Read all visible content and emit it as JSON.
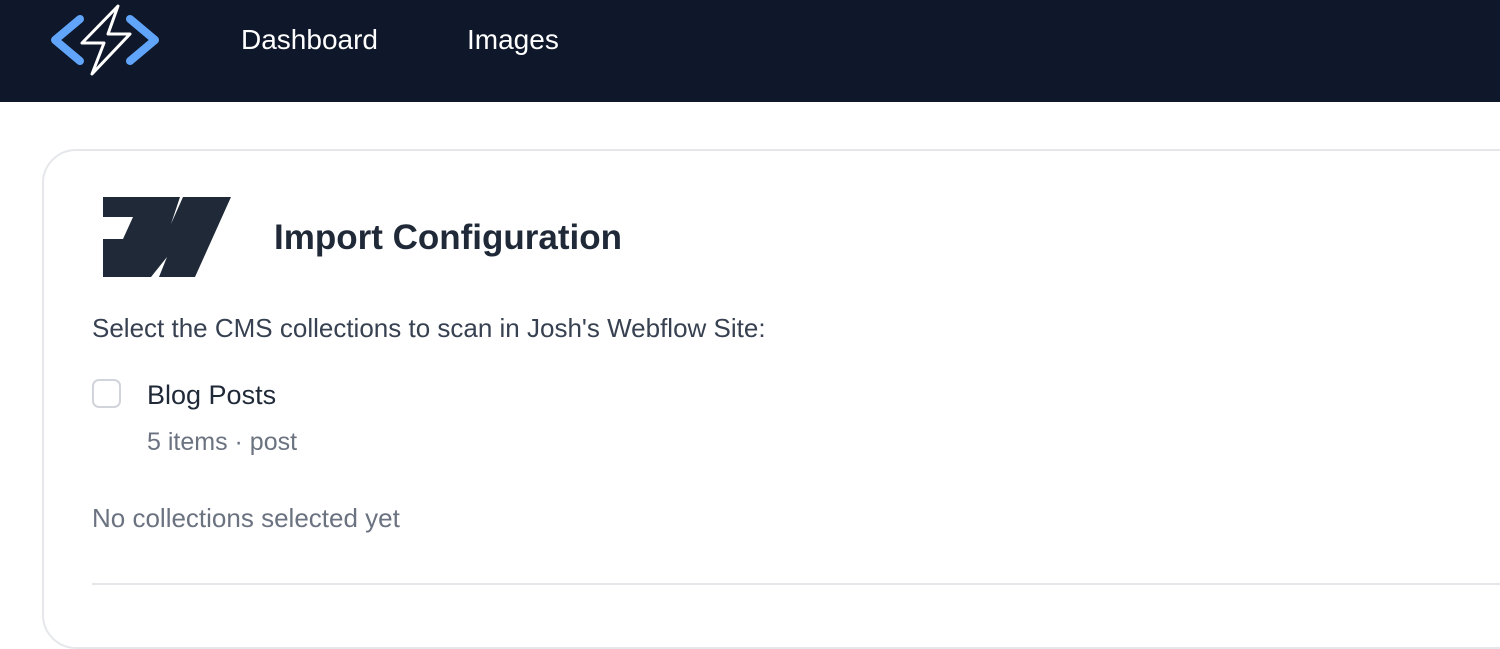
{
  "navbar": {
    "logo_icon": "lightning-code-logo-icon",
    "links": [
      "Dashboard",
      "Images"
    ]
  },
  "card": {
    "logo_icon": "webflow-logo-icon",
    "title": "Import Configuration",
    "instructions": "Select the CMS collections to scan in Josh's Webflow Site:",
    "collections": [
      {
        "name": "Blog Posts",
        "meta": "5 items · post",
        "checked": false
      }
    ],
    "empty_status": "No collections selected yet"
  },
  "colors": {
    "navbar_bg": "#0f172a",
    "logo_blue": "#60a5fa",
    "text_dark": "#1f2937",
    "text_muted": "#6b7280",
    "border": "#e5e7eb"
  }
}
